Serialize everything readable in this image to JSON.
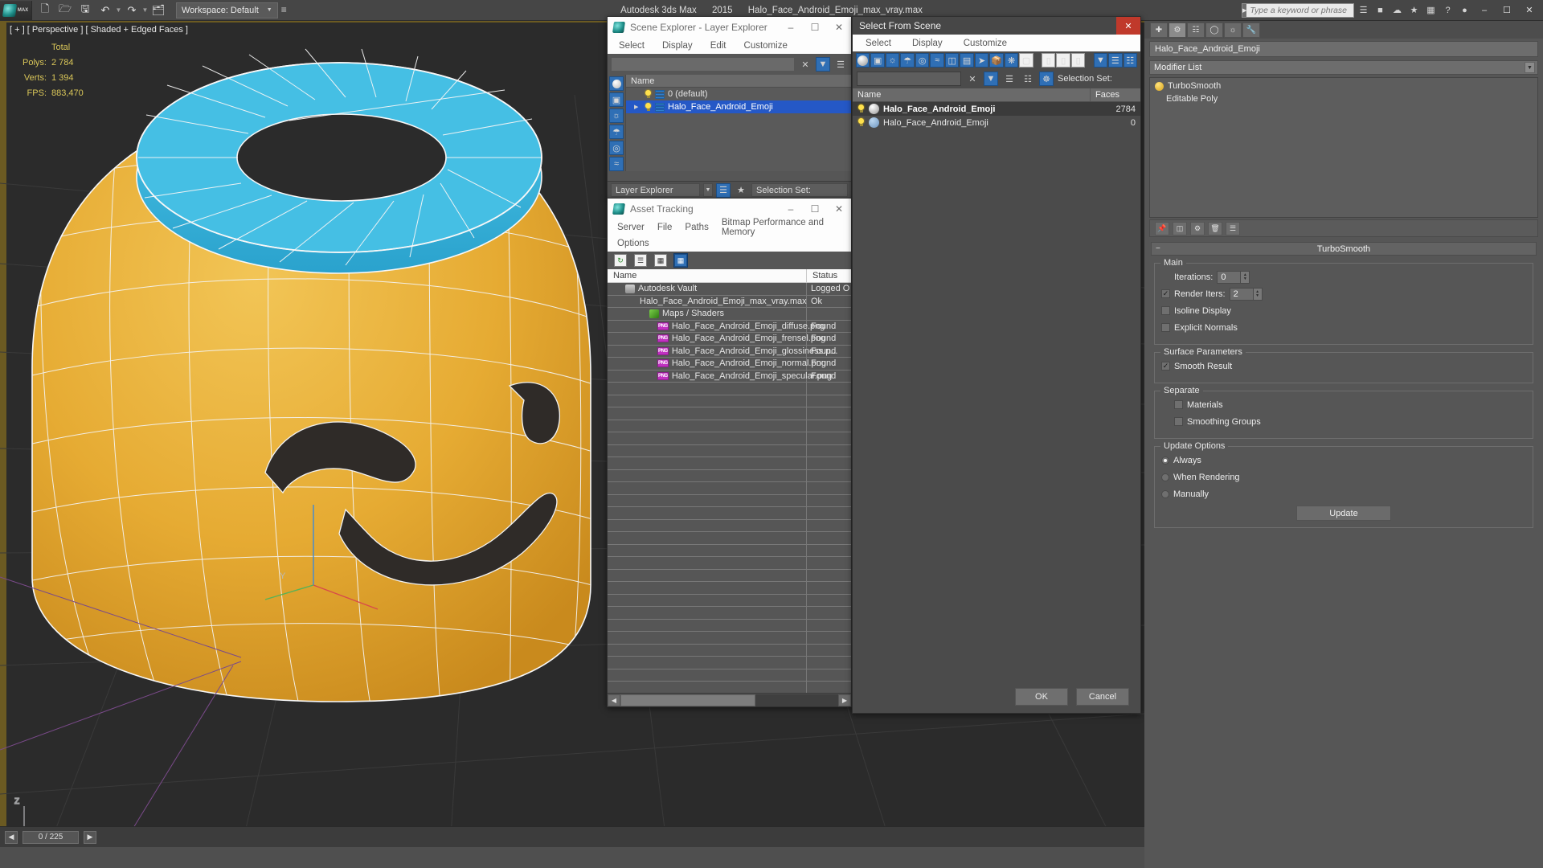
{
  "app": {
    "title_product": "Autodesk 3ds Max",
    "title_version": "2015",
    "title_file": "Halo_Face_Android_Emoji_max_vray.max",
    "workspace_label": "Workspace: Default",
    "search_placeholder": "Type a keyword or phrase"
  },
  "viewport": {
    "label": "[ + ] [ Perspective ] [ Shaded + Edged Faces ]",
    "stats": {
      "col_header": "Total",
      "rows": [
        {
          "label": "Polys:",
          "value": "2 784"
        },
        {
          "label": "Verts:",
          "value": "1 394"
        },
        {
          "label": "FPS:",
          "value": "883,470"
        }
      ]
    },
    "statusbar": {
      "frame_counter": "0 / 225"
    }
  },
  "scene_explorer": {
    "title": "Scene Explorer - Layer Explorer",
    "menus": [
      "Select",
      "Display",
      "Edit",
      "Customize"
    ],
    "column_header": "Name",
    "rows": [
      {
        "name": "0 (default)",
        "selected": false,
        "expandable": false
      },
      {
        "name": "Halo_Face_Android_Emoji",
        "selected": true,
        "expandable": true
      }
    ],
    "footer": {
      "mode": "Layer Explorer",
      "selection_set_label": "Selection Set:"
    }
  },
  "asset_tracking": {
    "title": "Asset Tracking",
    "menus": [
      "Server",
      "File",
      "Paths",
      "Bitmap Performance and Memory",
      "Options"
    ],
    "columns": [
      "Name",
      "Status"
    ],
    "rows": [
      {
        "name": "Autodesk Vault",
        "status": "Logged O",
        "icon": "vault-icon",
        "indent": 0
      },
      {
        "name": "Halo_Face_Android_Emoji_max_vray.max",
        "status": "Ok",
        "icon": "max-file-icon",
        "indent": 1
      },
      {
        "name": "Maps / Shaders",
        "status": "",
        "icon": "maps-shaders-icon",
        "indent": 2
      },
      {
        "name": "Halo_Face_Android_Emoji_diffuse.png",
        "status": "Found",
        "icon": "png-icon",
        "indent": 3
      },
      {
        "name": "Halo_Face_Android_Emoji_frensel.png",
        "status": "Found",
        "icon": "png-icon",
        "indent": 3
      },
      {
        "name": "Halo_Face_Android_Emoji_glossiness.p...",
        "status": "Found",
        "icon": "png-icon",
        "indent": 3
      },
      {
        "name": "Halo_Face_Android_Emoji_normal.png",
        "status": "Found",
        "icon": "png-icon",
        "indent": 3
      },
      {
        "name": "Halo_Face_Android_Emoji_specular.png",
        "status": "Found",
        "icon": "png-icon",
        "indent": 3
      }
    ]
  },
  "select_from_scene": {
    "title": "Select From Scene",
    "menus": [
      "Select",
      "Display",
      "Customize"
    ],
    "selection_set_label": "Selection Set:",
    "columns": [
      "Name",
      "Faces"
    ],
    "rows": [
      {
        "name": "Halo_Face_Android_Emoji",
        "faces": "2784",
        "selected": true
      },
      {
        "name": "Halo_Face_Android_Emoji",
        "faces": "0",
        "selected": false
      }
    ],
    "buttons": {
      "ok": "OK",
      "cancel": "Cancel"
    }
  },
  "command_panel": {
    "object_name": "Halo_Face_Android_Emoji",
    "modifier_list_label": "Modifier List",
    "stack": [
      {
        "label": "TurboSmooth",
        "type": "modifier"
      },
      {
        "label": "Editable Poly",
        "type": "base"
      }
    ],
    "rollout": {
      "title": "TurboSmooth",
      "groups": [
        {
          "caption": "Main",
          "fields": [
            {
              "kind": "spinner",
              "label": "Iterations:",
              "value": "0",
              "checked": null
            },
            {
              "kind": "spinner",
              "label": "Render Iters:",
              "value": "2",
              "checked": true
            },
            {
              "kind": "checkbox",
              "label": "Isoline Display",
              "checked": false
            },
            {
              "kind": "checkbox",
              "label": "Explicit Normals",
              "checked": false
            }
          ]
        },
        {
          "caption": "Surface Parameters",
          "fields": [
            {
              "kind": "checkbox",
              "label": "Smooth Result",
              "checked": true
            }
          ]
        },
        {
          "caption": "Separate",
          "fields": [
            {
              "kind": "checkbox",
              "label": "Materials",
              "checked": false
            },
            {
              "kind": "checkbox",
              "label": "Smoothing Groups",
              "checked": false
            }
          ]
        },
        {
          "caption": "Update Options",
          "fields": [
            {
              "kind": "radio",
              "label": "Always",
              "checked": true
            },
            {
              "kind": "radio",
              "label": "When Rendering",
              "checked": false
            },
            {
              "kind": "radio",
              "label": "Manually",
              "checked": false
            }
          ],
          "button": "Update"
        }
      ]
    }
  },
  "colors": {
    "accent_blue": "#2f6fb5",
    "selection_blue": "#2558c6",
    "emoji_yellow": "#e8b03a",
    "halo_cyan": "#3ab5dd",
    "viewport_bg": "#2b2b2b",
    "stat_yellow": "#d9c659",
    "png_magenta": "#c131c1"
  }
}
